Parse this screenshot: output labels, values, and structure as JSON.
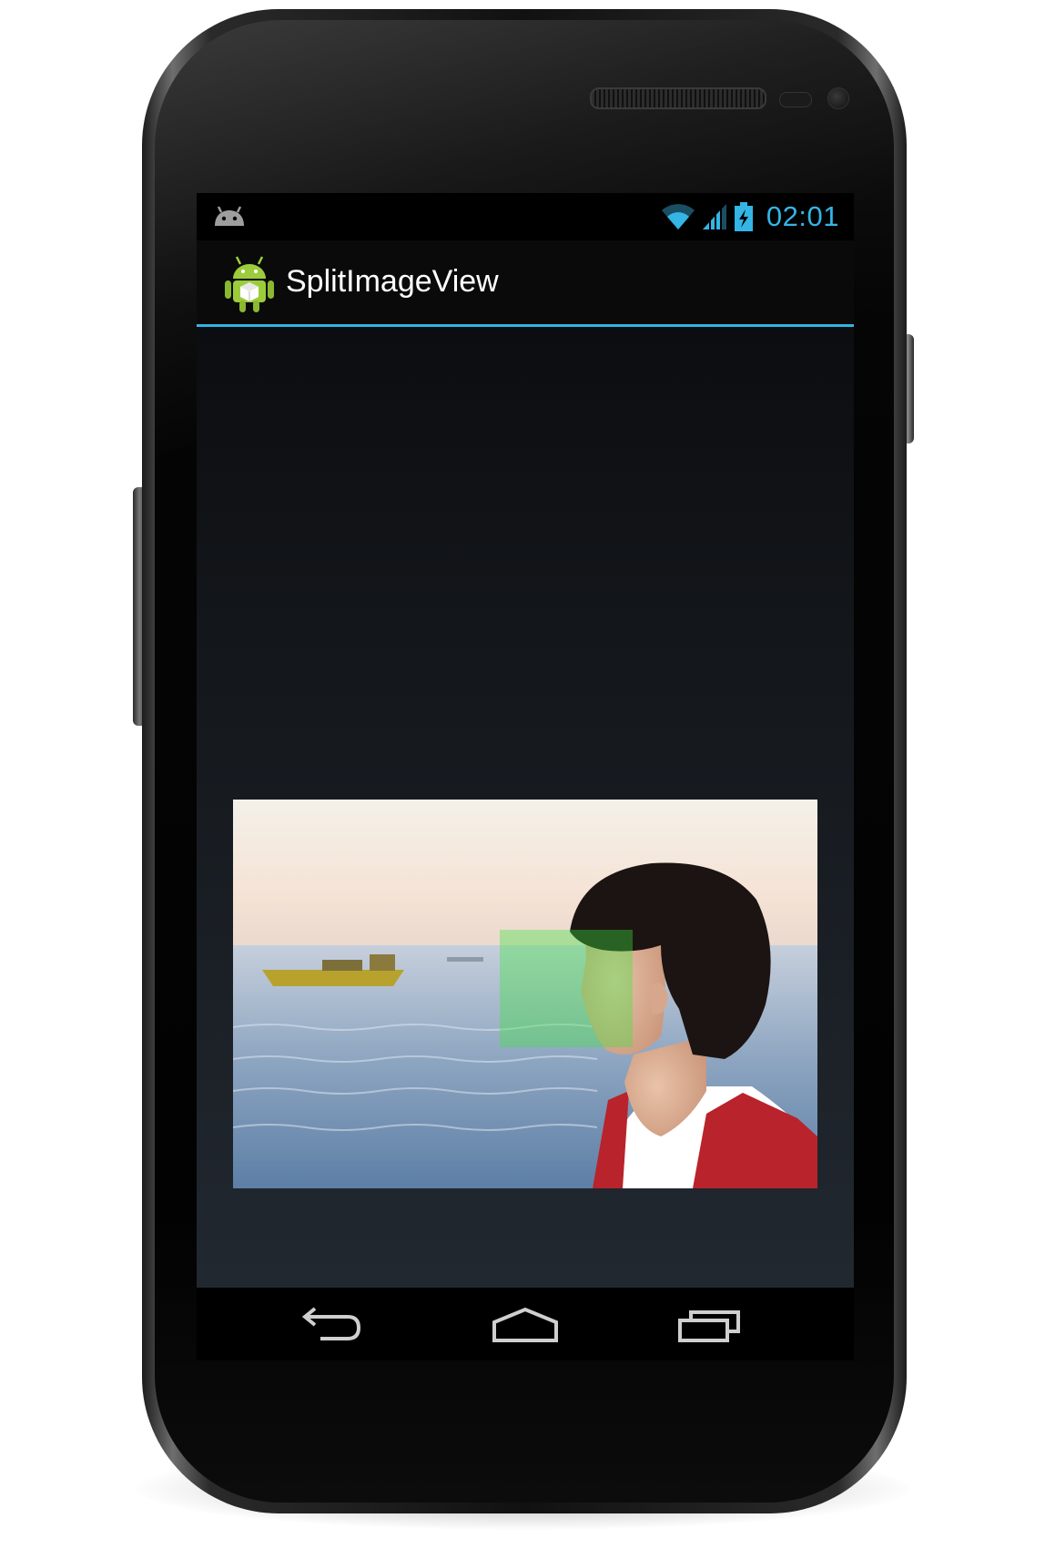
{
  "status_bar": {
    "time": "02:01",
    "accent_color": "#33b5e5",
    "notification_icon": "android-debug-icon",
    "icons": [
      "wifi-icon",
      "signal-icon",
      "battery-charging-icon"
    ]
  },
  "action_bar": {
    "app_icon": "android-app-icon",
    "title": "SplitImageView"
  },
  "content": {
    "image": "photo-person-by-sea",
    "overlay": "green-split-selection-square"
  },
  "nav_bar": {
    "buttons": [
      "back-icon",
      "home-icon",
      "recent-apps-icon"
    ]
  }
}
